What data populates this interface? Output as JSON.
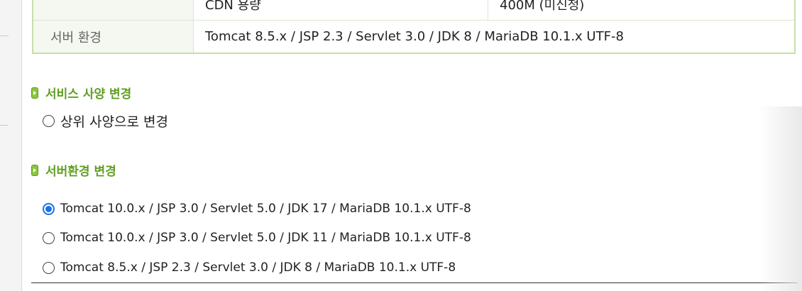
{
  "spec_table": {
    "rows": [
      {
        "label": "",
        "value1": "CDN 용량",
        "value2": "400M (미신청)"
      },
      {
        "label": "서버 환경",
        "value1": "Tomcat 8.5.x / JSP 2.3 / Servlet 3.0 / JDK 8 / MariaDB 10.1.x UTF-8",
        "value2": ""
      }
    ]
  },
  "service_change": {
    "title": "서비스 사양 변경",
    "options": [
      {
        "label": "상위 사양으로 변경",
        "checked": false
      }
    ]
  },
  "env_change": {
    "title": "서버환경 변경",
    "options": [
      {
        "label": "Tomcat 10.0.x / JSP 3.0 / Servlet 5.0 / JDK 17 / MariaDB 10.1.x UTF-8",
        "checked": true
      },
      {
        "label": "Tomcat 10.0.x / JSP 3.0 / Servlet 5.0 / JDK 11 / MariaDB 10.1.x UTF-8",
        "checked": false
      },
      {
        "label": "Tomcat 8.5.x / JSP 2.3 / Servlet 3.0 / JDK 8 / MariaDB 10.1.x UTF-8",
        "checked": false
      }
    ]
  },
  "colors": {
    "accent_green": "#5f9f22",
    "table_border": "#c5e0a8",
    "radio_selected": "#1a73e8"
  }
}
